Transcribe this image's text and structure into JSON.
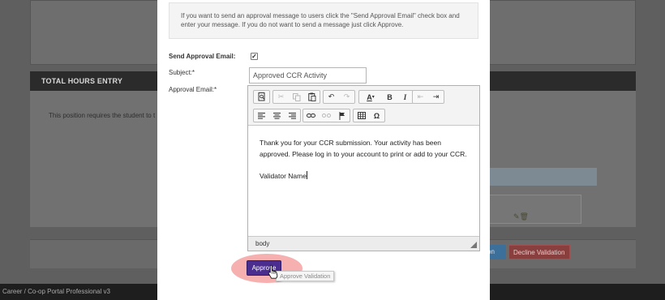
{
  "background": {
    "section_header": "TOTAL HOURS ENTRY",
    "body_text": "This position requires the student to t",
    "blue_button_label": "on",
    "decline_button_label": "Decline Validation",
    "footer_text": "Career / Co-op Portal Professional v3"
  },
  "modal": {
    "info_text": "If you want to send an approval message to users click the \"Send Approval Email\" check box and enter your message. If you do not want to send a message just click Approve.",
    "send_label": "Send Approval Email:",
    "send_checked": "✓",
    "subject_label": "Subject:*",
    "subject_value": "Approved CCR Activity",
    "email_label": "Approval Email:*",
    "editor": {
      "paragraph1": "Thank you for your CCR submission.  Your activity has been approved.  Please log in to your account to print or add to your CCR.",
      "paragraph2": "Validator Name",
      "status_path": "body"
    },
    "approve_label": "Approve",
    "tooltip_text": "Approve Validation"
  }
}
